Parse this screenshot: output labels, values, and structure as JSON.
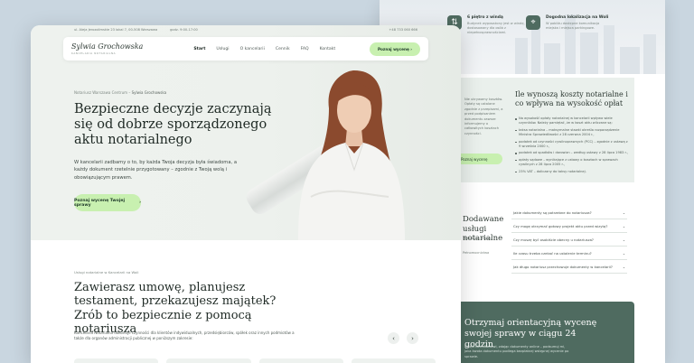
{
  "topbar": {
    "address": "ul. Aleja Jerozolimskie 23 lokal 7, 00-508 Warszawa",
    "hours": "godz. 9:00-17:00",
    "phone": "+48 733 060 666"
  },
  "nav": {
    "logo_name": "Sylwia Grochowska",
    "logo_sub": "KANCELARIA NOTARIALNA",
    "items": [
      "Start",
      "Usługi",
      "O kancelarii",
      "Cennik",
      "FAQ",
      "Kontakt"
    ],
    "cta": "Poznaj wycenę"
  },
  "hero": {
    "breadcrumb_root": "Notariusz Warszawa Centrum",
    "breadcrumb_current": "Sylwia Grochowska",
    "title": "Bezpieczne decyzje zaczynają się od dobrze sporządzonego aktu notarialnego",
    "text": "W kancelarii zadbamy o to, by każda Twoja decyzja była świadoma, a każdy dokument rzetelnie przygotowany – zgodnie z Twoją wolą i obowiązującym prawem.",
    "button": "Poznaj wycenę Twojej sprawy",
    "button_icon": "chevron-right-icon"
  },
  "services": {
    "eyebrow": "Usługi notarialne w Kancelarii na Woli",
    "title": "Zawierasz umowę, planujesz testament, przekazujesz majątek? Zrób to bezpiecznie z pomocą notariusza",
    "text": "Kancelaria Notarialna dokonuje czynności dla klientów indywidualnych, przedsiębiorców, spółek oraz innych podmiotów a także dla organów administracji publicznej w poniższym zakresie:",
    "prev_icon": "chevron-left-icon",
    "next_icon": "chevron-right-icon"
  },
  "back_page": {
    "feature1_title": "6 piętro z windą",
    "feature1_text": "Budynek wyposażony jest w windę, dostosowany dla osób z niepełnosprawnościami.",
    "feature2_title": "Dogodna lokalizacja na Woli",
    "feature2_text": "W pobliżu dostępne komunikacja miejska i miejsca parkingowe.",
    "costs_left": "Nie ukrywamy kosztów. Opłaty są ustalane zgodnie z przepisami, a przed podpisaniem dokumentu zawsze informujemy o całkowitych kosztach czynności.",
    "costs_button": "Poznaj wycenę",
    "costs_title": "Ile wynoszą koszty notarialne i co wpływa na wysokość opłat",
    "costs_list": [
      "Na wysokość opłaty notarialnej w kancelarii wpływa wiele czynników. Należy pamiętać, że w koszt aktu wliczane są:",
      "taksa notarialna – maksymalne stawki określa rozporządzenie Ministra Sprawiedliwości z 28 czerwca 2004 r.,",
      "podatek od czynności cywilnoprawnych (PCC) – zgodnie z ustawą z 9 września 2000 r.,",
      "podatek od spadków i darowizn – według ustawy z 28 lipca 1983 r.,",
      "opłaty sądowe – wynikające z ustawy o kosztach w sprawach cywilnych z 28 lipca 2005 r.,",
      "23% VAT – doliczany do taksy notarialnej."
    ],
    "services_title": "Dodawane usługi notarialne",
    "services_small1": "Notarialne umowy",
    "services_small2": "Pełnomocnictwa",
    "faq": [
      "Jakie dokumenty są potrzebne do notariusza?",
      "Czy mogę otrzymać gotowy projekt aktu przed wizytą?",
      "Czy muszę być osobiście obecny u notariusza?",
      "Ile czasu trzeba czekać na ustalenie terminu?",
      "Jak długo notariusz przechowuje dokumenty w kancelarii?"
    ],
    "cta_title": "Otrzymaj orientacyjną wycenę swojej sprawy w ciągu 24 godzin",
    "cta_text": "Dzięki formularzowi, zdając dokumenty online – podsumuj mi, jaka kwota dokumentu podlega bezpłatnej wstępnej wycenie po sprawie."
  },
  "colors": {
    "accent": "#c8f0b0",
    "dark_green": "#4f6b60",
    "hero_bg": "#eef2ee",
    "page_bg": "#c9d6e0"
  }
}
